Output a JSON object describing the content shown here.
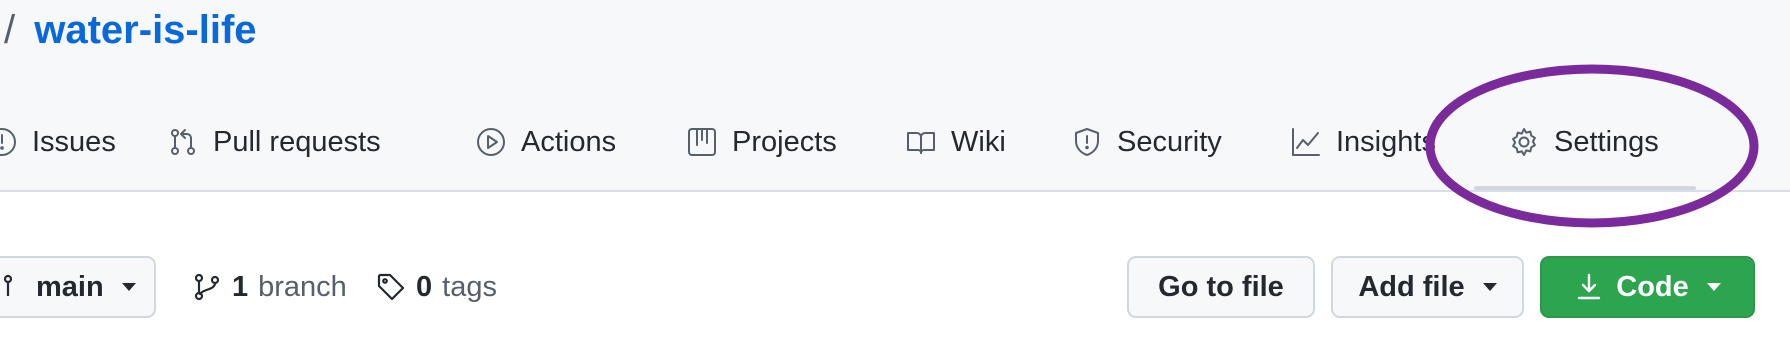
{
  "repo": {
    "separator": "/",
    "name": "water-is-life"
  },
  "tabs": [
    {
      "label": "Issues",
      "icon": "issue-icon"
    },
    {
      "label": "Pull requests",
      "icon": "pull-request-icon"
    },
    {
      "label": "Actions",
      "icon": "play-icon"
    },
    {
      "label": "Projects",
      "icon": "project-board-icon"
    },
    {
      "label": "Wiki",
      "icon": "book-icon"
    },
    {
      "label": "Security",
      "icon": "shield-icon"
    },
    {
      "label": "Insights",
      "icon": "graph-icon"
    },
    {
      "label": "Settings",
      "icon": "gear-icon",
      "selected": true
    }
  ],
  "highlight": {
    "target": "Settings",
    "color": "#7b2a9c"
  },
  "toolbar": {
    "branch_selector": "main",
    "branches_count": "1",
    "branches_label": "branch",
    "tags_count": "0",
    "tags_label": "tags",
    "go_to_file": "Go to file",
    "add_file": "Add file",
    "code": "Code"
  },
  "colors": {
    "link": "#0969da",
    "code_button": "#2da44e",
    "highlight": "#7b2a9c"
  }
}
